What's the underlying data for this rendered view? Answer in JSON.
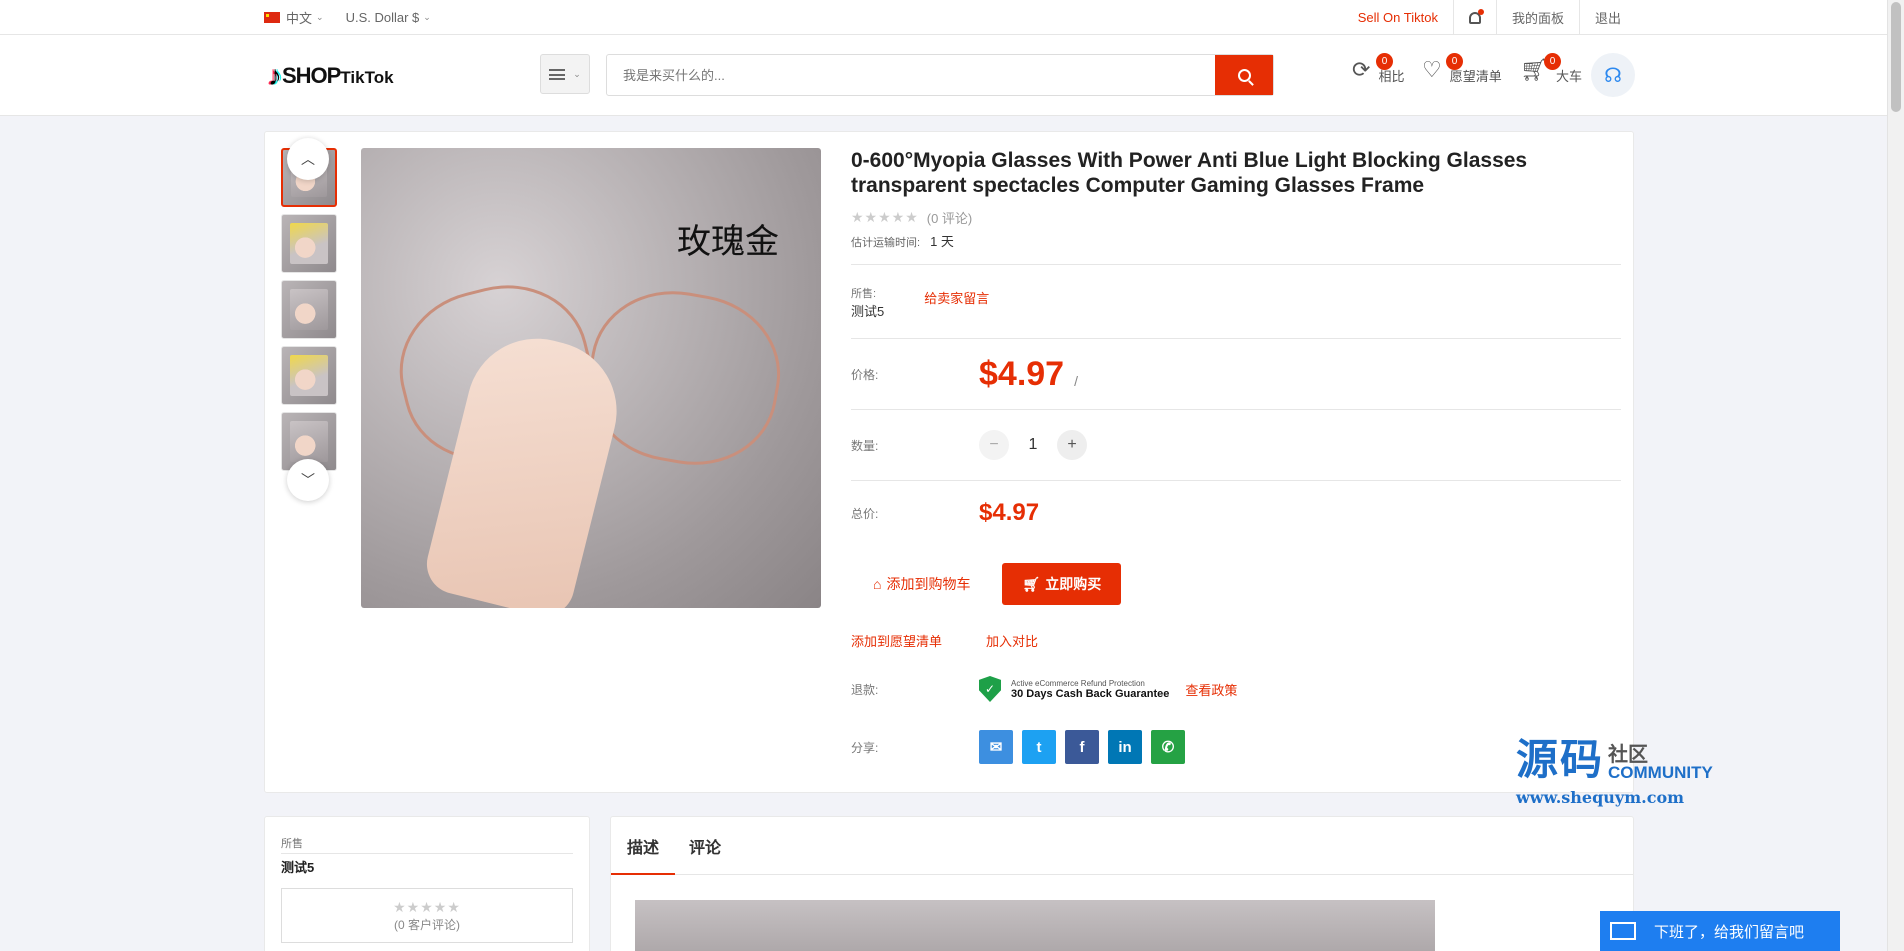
{
  "topbar": {
    "language": "中文",
    "currency": "U.S. Dollar $",
    "sell_link": "Sell On Tiktok",
    "dashboard": "我的面板",
    "logout": "退出"
  },
  "header": {
    "logo_shop": "SHOP",
    "logo_tiktok": "TikTok",
    "search_placeholder": "我是来买什么的...",
    "compare_label": "相比",
    "compare_count": "0",
    "wishlist_label": "愿望清单",
    "wishlist_count": "0",
    "cart_label": "大车",
    "cart_count": "0"
  },
  "product": {
    "image_caption": "玫瑰金",
    "title": "0-600°Myopia Glasses With Power Anti Blue Light Blocking Glasses transparent spectacles Computer Gaming Glasses Frame",
    "stars": "★★★★★",
    "reviews": "(0 评论)",
    "ship_label": "估计运输时间:",
    "ship_value": "1 天",
    "sold_by_label": "所售:",
    "seller": "测试5",
    "message_seller": "给卖家留言",
    "price_label": "价格:",
    "price": "$4.97",
    "price_unit": "/",
    "qty_label": "数量:",
    "qty": "1",
    "total_label": "总价:",
    "total": "$4.97",
    "add_to_cart": "添加到购物车",
    "buy_now": "立即购买",
    "add_wishlist": "添加到愿望清单",
    "add_compare": "加入对比",
    "refund_label": "退款:",
    "refund_line1": "Active eCommerce Refund Protection",
    "refund_line2": "30 Days Cash Back Guarantee",
    "view_policy": "查看政策",
    "share_label": "分享:"
  },
  "share_buttons": [
    {
      "name": "email",
      "glyph": "✉",
      "color": "#3d8fe0"
    },
    {
      "name": "twitter",
      "glyph": "t",
      "color": "#1da1f2"
    },
    {
      "name": "facebook",
      "glyph": "f",
      "color": "#3b5998"
    },
    {
      "name": "linkedin",
      "glyph": "in",
      "color": "#0077b5"
    },
    {
      "name": "whatsapp",
      "glyph": "✆",
      "color": "#25a244"
    }
  ],
  "watermark": {
    "big": "源码",
    "small_a": "社区",
    "small_b": "COMMUNITY",
    "url": "www.shequym.com"
  },
  "seller_box": {
    "label": "所售",
    "name": "测试5",
    "stars": "★★★★★",
    "reviews": "(0 客户评论)"
  },
  "tabs": [
    "描述",
    "评论"
  ],
  "chat": {
    "label": "下班了，给我们留言吧"
  },
  "colors": {
    "accent": "#e62e04"
  }
}
